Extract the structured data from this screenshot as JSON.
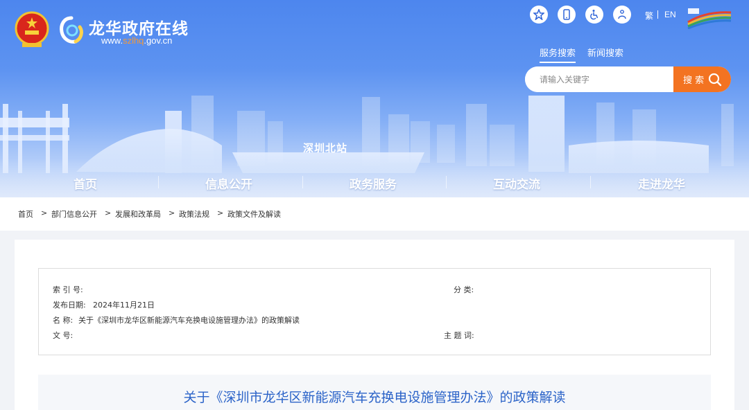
{
  "header": {
    "site_title": "龙华政府在线",
    "site_url_prefix": "www.",
    "site_url_highlight": "szlhq",
    "site_url_suffix": ".gov.cn",
    "lang_traditional": "繁",
    "lang_english": "EN",
    "utility_icons": [
      "star-service-icon",
      "mobile-icon",
      "accessibility-icon",
      "elderly-care-icon"
    ],
    "banner_station_label": "深圳北站"
  },
  "search": {
    "tabs": [
      "服务搜索",
      "新闻搜索"
    ],
    "active_tab": "服务搜索",
    "placeholder": "请输入关键字",
    "button_label": "搜 索"
  },
  "nav": {
    "items": [
      "首页",
      "信息公开",
      "政务服务",
      "互动交流",
      "走进龙华"
    ]
  },
  "breadcrumb": [
    "首页",
    "部门信息公开",
    "发展和改革局",
    "政策法规",
    "政策文件及解读"
  ],
  "breadcrumb_sep": ">",
  "meta": {
    "index_label": "索 引 号:",
    "index_value": "",
    "category_label": "分 类:",
    "category_value": "",
    "date_label": "发布日期:",
    "date_value": "2024年11月21日",
    "name_label": "名 称:",
    "name_value": "关于《深圳市龙华区新能源汽车充换电设施管理办法》的政策解读",
    "docno_label": "文 号:",
    "docno_value": "",
    "keywords_label": "主 题 词:",
    "keywords_value": ""
  },
  "article": {
    "title": "关于《深圳市龙华区新能源汽车充换电设施管理办法》的政策解读"
  },
  "colors": {
    "banner_top": "#4d86ee",
    "accent_orange": "#f37321",
    "title_blue": "#2b63c8"
  }
}
